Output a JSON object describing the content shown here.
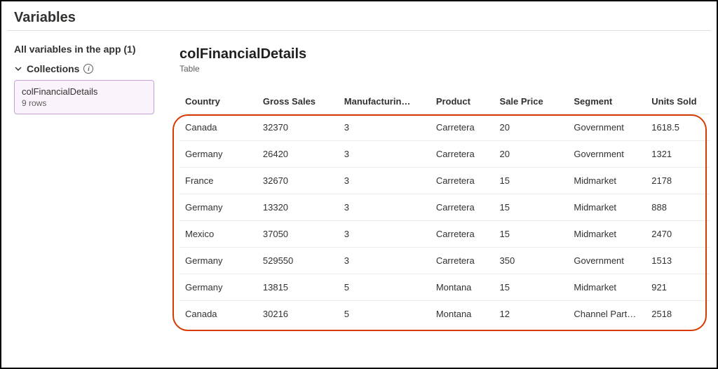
{
  "page": {
    "title": "Variables"
  },
  "sidebar": {
    "heading": "All variables in the app",
    "count": "(1)",
    "section_label": "Collections",
    "card": {
      "name": "colFinancialDetails",
      "rows_label": "9 rows"
    }
  },
  "main": {
    "title": "colFinancialDetails",
    "type_label": "Table",
    "columns": [
      "Country",
      "Gross Sales",
      "Manufacturin…",
      "Product",
      "Sale Price",
      "Segment",
      "Units Sold"
    ],
    "rows": [
      [
        "Canada",
        "32370",
        "3",
        "Carretera",
        "20",
        "Government",
        "1618.5"
      ],
      [
        "Germany",
        "26420",
        "3",
        "Carretera",
        "20",
        "Government",
        "1321"
      ],
      [
        "France",
        "32670",
        "3",
        "Carretera",
        "15",
        "Midmarket",
        "2178"
      ],
      [
        "Germany",
        "13320",
        "3",
        "Carretera",
        "15",
        "Midmarket",
        "888"
      ],
      [
        "Mexico",
        "37050",
        "3",
        "Carretera",
        "15",
        "Midmarket",
        "2470"
      ],
      [
        "Germany",
        "529550",
        "3",
        "Carretera",
        "350",
        "Government",
        "1513"
      ],
      [
        "Germany",
        "13815",
        "5",
        "Montana",
        "15",
        "Midmarket",
        "921"
      ],
      [
        "Canada",
        "30216",
        "5",
        "Montana",
        "12",
        "Channel Partners",
        "2518"
      ]
    ]
  }
}
